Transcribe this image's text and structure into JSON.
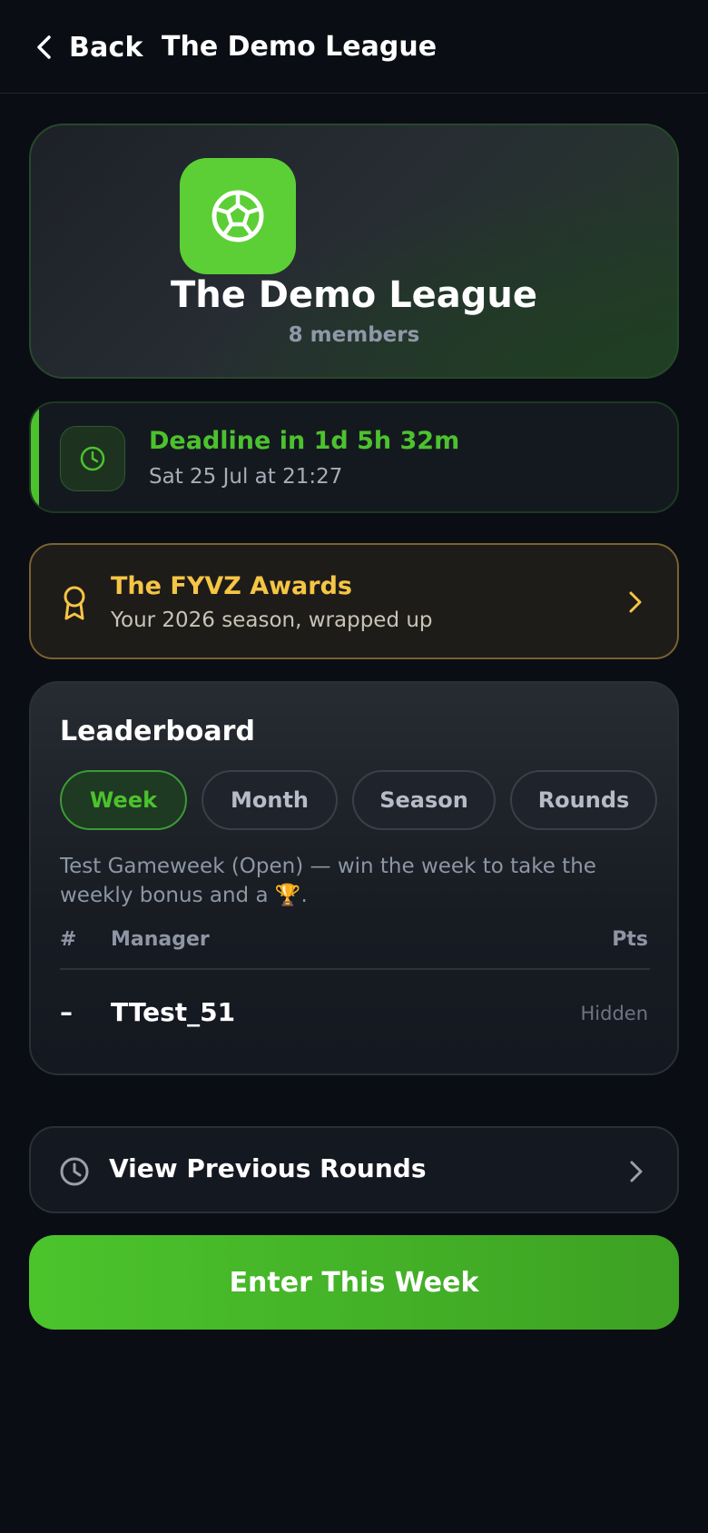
{
  "header": {
    "back_label": "Back",
    "title": "The Demo League",
    "icons": {
      "back": "chevron-left-icon"
    }
  },
  "hero": {
    "league_name": "The Demo League",
    "members": "8 members",
    "logo_icon": "soccer-ball-icon",
    "logo_color": "#5ccf36"
  },
  "deadline": {
    "title": "Deadline in 1d 5h 32m",
    "subtitle": "Sat 25 Jul at 21:27",
    "icon": "clock-icon",
    "accent_color": "#4cc22e"
  },
  "awards": {
    "title": "The FYVZ Awards",
    "subtitle": "Your 2026 season, wrapped up",
    "icon": "award-ribbon-icon",
    "accent_color": "#f6c545"
  },
  "leaderboard": {
    "title": "Leaderboard",
    "tabs": [
      {
        "label": "Week",
        "active": true
      },
      {
        "label": "Month",
        "active": false
      },
      {
        "label": "Season",
        "active": false
      },
      {
        "label": "Rounds",
        "active": false
      }
    ],
    "description": "Test Gameweek (Open) — win the week to take the weekly bonus and a 🏆.",
    "columns": {
      "rank": "#",
      "manager": "Manager",
      "points": "Pts"
    },
    "rows": [
      {
        "rank": "–",
        "manager": "TTest_51",
        "points": "Hidden"
      }
    ]
  },
  "previous_rounds": {
    "label": "View Previous Rounds",
    "icon": "clock-icon"
  },
  "cta": {
    "label": "Enter This Week",
    "color": "#4bc42c"
  }
}
